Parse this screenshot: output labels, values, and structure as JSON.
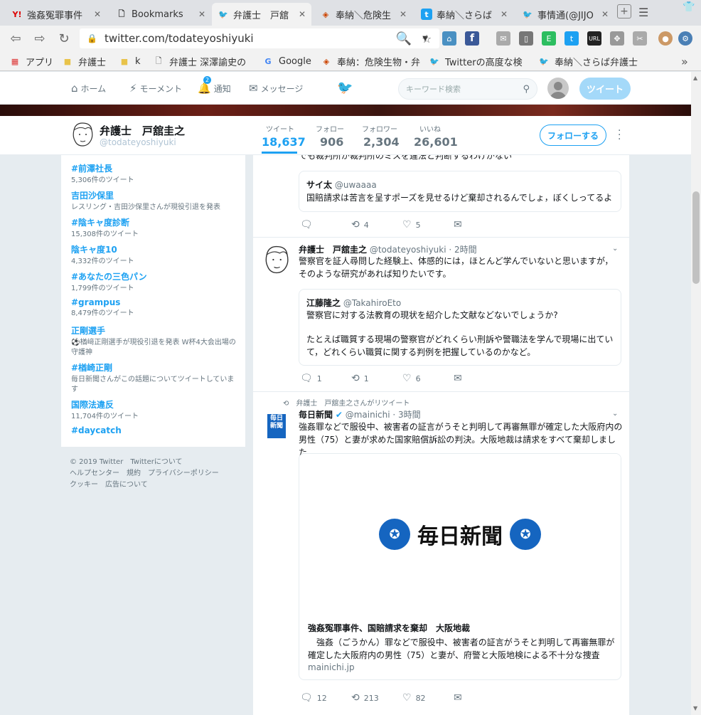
{
  "browser": {
    "tabs": [
      {
        "label": "強姦冤罪事件",
        "icon": "Y!"
      },
      {
        "label": "Bookmarks",
        "icon": "page-icon"
      },
      {
        "label": "弁護士　戸舘",
        "icon": "twitter-bird-icon"
      },
      {
        "label": "奉納＼危険生",
        "icon": "blog-icon"
      },
      {
        "label": "奉納＼さらば",
        "icon": "t-icon"
      },
      {
        "label": "事情通(@JIJO",
        "icon": "twitter-bird-icon"
      }
    ],
    "url": "twitter.com/todateyoshiyuki",
    "bookmarks": [
      {
        "label": "アプリ",
        "icon": "apps-grid-icon"
      },
      {
        "label": "弁護士",
        "icon": "folder-icon"
      },
      {
        "label": "k",
        "icon": "folder-icon"
      },
      {
        "label": "弁護士 深澤諭史の",
        "icon": "page-icon"
      },
      {
        "label": "Google",
        "icon": "google-icon"
      },
      {
        "label": "奉納：危険生物・弁",
        "icon": "blog-icon"
      },
      {
        "label": "Twitterの高度な検",
        "icon": "twitter-bird-icon"
      },
      {
        "label": "奉納＼さらば弁護士",
        "icon": "twitter-bird-icon"
      }
    ]
  },
  "twitter_nav": {
    "home": "ホーム",
    "moments": "モーメント",
    "notifications": "通知",
    "notification_count": "2",
    "messages": "メッセージ",
    "search_placeholder": "キーワード検索",
    "tweet_button": "ツイート"
  },
  "profile": {
    "name": "弁護士　戸舘圭之",
    "handle": "@todateyoshiyuki",
    "stats": [
      {
        "label": "ツイート",
        "value": "18,637"
      },
      {
        "label": "フォロー",
        "value": "906"
      },
      {
        "label": "フォロワー",
        "value": "2,304"
      },
      {
        "label": "いいね",
        "value": "26,601"
      }
    ],
    "follow_button": "フォローする"
  },
  "trends": [
    {
      "name": "#前澤社長",
      "meta": "5,306件のツイート"
    },
    {
      "name": "吉田沙保里",
      "meta": "レスリング・吉田沙保里さんが現役引退を発表"
    },
    {
      "name": "#陰キャ度診断",
      "meta": "15,308件のツイート"
    },
    {
      "name": "陰キャ度10",
      "meta": "4,332件のツイート"
    },
    {
      "name": "#あなたの三色パン",
      "meta": "1,799件のツイート"
    },
    {
      "name": "#grampus",
      "meta": "8,479件のツイート"
    },
    {
      "name": "正剛選手",
      "meta": "⚽楢﨑正剛選手が現役引退を発表 W杯4大会出場の守護神"
    },
    {
      "name": "#楢崎正剛",
      "meta": "毎日新聞さんがこの話題についてツイートしています"
    },
    {
      "name": "国際法違反",
      "meta": "11,704件のツイート"
    },
    {
      "name": "#daycatch",
      "meta": ""
    }
  ],
  "footer": {
    "line1": "© 2019 Twitter　Twitterについて",
    "line2": "ヘルプセンター　規約　プライバシーポリシー",
    "line3": "クッキー　広告について"
  },
  "timeline": {
    "partial_text": "でも裁判所が裁判所のミスを違法と判断するわけがない",
    "tweet1_quote": {
      "name": "サイ太",
      "handle": "@uwaaaa",
      "text": "国賠請求は苦言を呈すポーズを見せるけど棄却されるんでしょ，ぼくしってるよ"
    },
    "tweet1_actions": {
      "replies": "",
      "retweets": "4",
      "likes": "5"
    },
    "tweet2": {
      "name": "弁護士　戸舘圭之",
      "handle": "@todateyoshiyuki",
      "time": "· 2時間",
      "text": "警察官を証人尋問した経験上、体感的には，ほとんど学んでいないと思いますが，そのような研究があれば知りたいです。"
    },
    "tweet2_quote": {
      "name": "江藤隆之",
      "handle": "@TakahiroEto",
      "text1": "警察官に対する法教育の現状を紹介した文献などないでしょうか?",
      "text2": "たとえば職質する現場の警察官がどれくらい刑訴や警職法を学んで現場に出ていて，どれくらい職質に関する判例を把握しているのかなど。"
    },
    "tweet2_actions": {
      "replies": "1",
      "retweets": "1",
      "likes": "6"
    },
    "tweet3": {
      "retweet_note": "弁護士　戸舘圭之さんがリツイート",
      "name": "毎日新聞",
      "handle": "@mainichi",
      "time": "· 3時間",
      "text": "強姦罪などで服役中、被害者の証言がうそと判明して再審無罪が確定した大阪府内の男性（75）と妻が求めた国家賠償訴訟の判決。大阪地裁は請求をすべて棄却しました。",
      "avatar_text": "毎日新聞",
      "card_logo": "毎日新聞",
      "card_title": "強姦冤罪事件、国賠請求を棄却　大阪地裁",
      "card_desc": "　強姦（ごうかん）罪などで服役中、被害者の証言がうそと判明して再審無罪が確定した大阪府内の男性（75）と妻が、府警と大阪地検による不十分な捜査や...",
      "card_domain": "mainichi.jp"
    },
    "tweet3_actions": {
      "replies": "12",
      "retweets": "213",
      "likes": "82"
    }
  },
  "colors": {
    "twitter_blue": "#1da1f2",
    "mainichi_blue": "#1565c0"
  }
}
